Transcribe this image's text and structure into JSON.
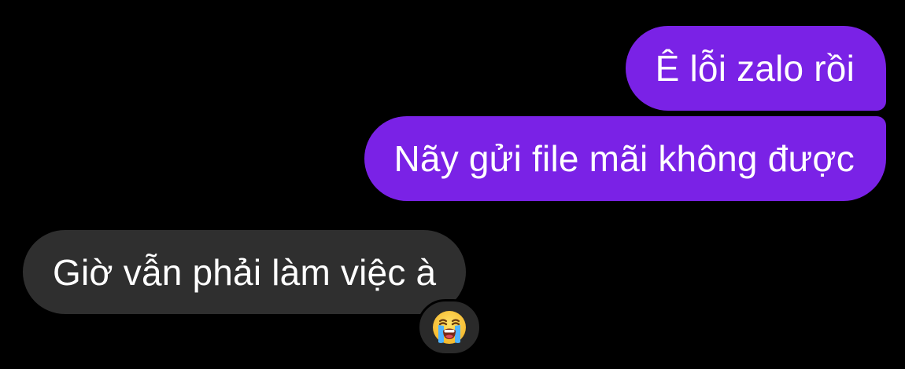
{
  "conversation": {
    "messages": [
      {
        "sender": "me",
        "text": "Ê lỗi zalo rồi"
      },
      {
        "sender": "me",
        "text": "Nãy gửi file mãi không được"
      },
      {
        "sender": "other",
        "text": "Giờ vẫn phải làm việc à"
      }
    ],
    "reaction": {
      "icon": "loudly-crying-face-icon"
    }
  },
  "colors": {
    "background": "#000000",
    "outgoing_bubble": "#7a22e6",
    "incoming_bubble": "#2f2f2f",
    "text": "#ffffff"
  }
}
